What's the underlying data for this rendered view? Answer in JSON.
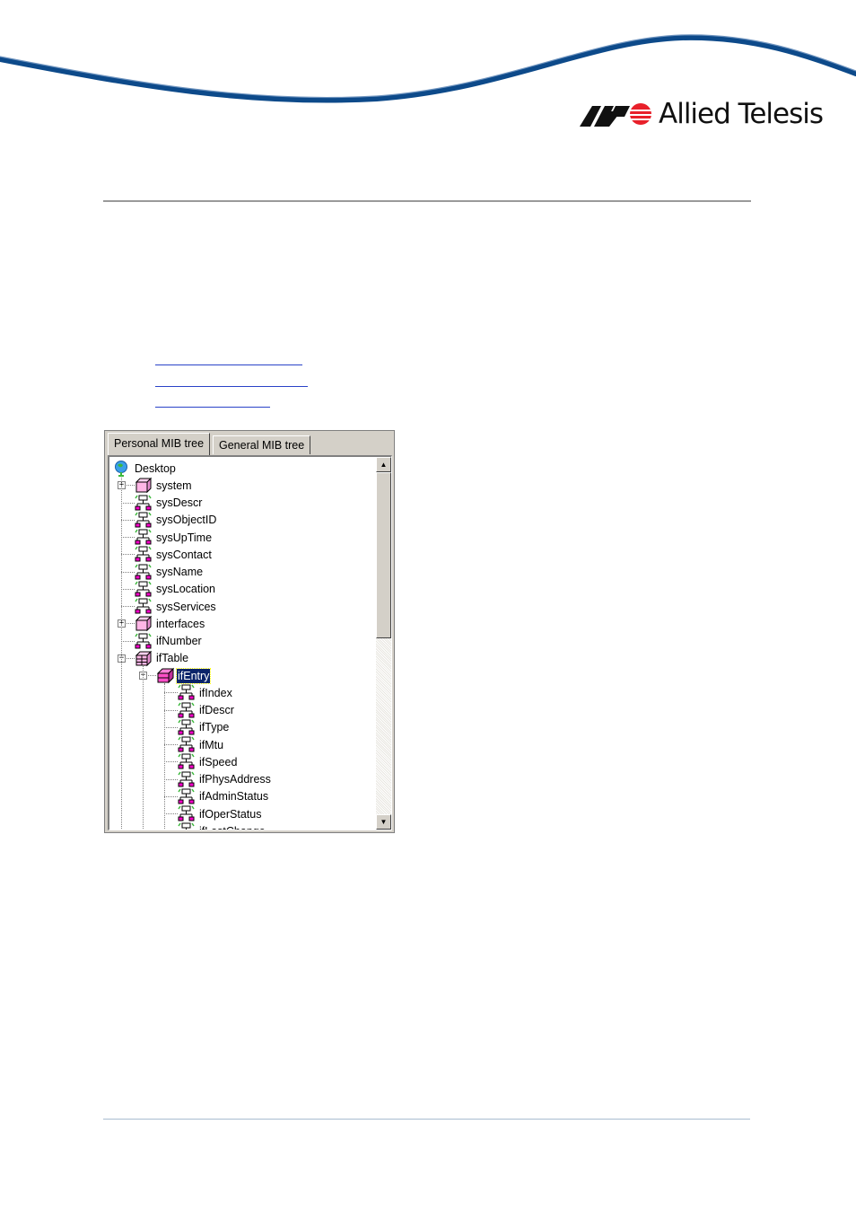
{
  "brand": {
    "name": "Allied Telesis",
    "swoosh_color": "#0d4a8a",
    "logo_accent": "#e8202a"
  },
  "mib_browser": {
    "tabs": [
      {
        "label": "Personal MIB tree",
        "active": true
      },
      {
        "label": "General MIB tree",
        "active": false
      }
    ],
    "tree": [
      {
        "label": "Desktop",
        "icon": "globe-icon",
        "level": 0
      },
      {
        "label": "system",
        "icon": "folder-cube-icon",
        "level": 1,
        "expander": "+"
      },
      {
        "label": "sysDescr",
        "icon": "mib-object-icon",
        "level": 1
      },
      {
        "label": "sysObjectID",
        "icon": "mib-object-icon",
        "level": 1
      },
      {
        "label": "sysUpTime",
        "icon": "mib-object-icon",
        "level": 1
      },
      {
        "label": "sysContact",
        "icon": "mib-object-icon",
        "level": 1
      },
      {
        "label": "sysName",
        "icon": "mib-object-icon",
        "level": 1
      },
      {
        "label": "sysLocation",
        "icon": "mib-object-icon",
        "level": 1
      },
      {
        "label": "sysServices",
        "icon": "mib-object-icon",
        "level": 1
      },
      {
        "label": "interfaces",
        "icon": "folder-cube-icon",
        "level": 1,
        "expander": "+"
      },
      {
        "label": "ifNumber",
        "icon": "mib-object-icon",
        "level": 1
      },
      {
        "label": "ifTable",
        "icon": "table-cube-icon",
        "level": 1,
        "expander": "-"
      },
      {
        "label": "ifEntry",
        "icon": "entry-cube-icon",
        "level": 2,
        "expander": "-",
        "selected": true
      },
      {
        "label": "ifIndex",
        "icon": "mib-object-icon",
        "level": 3
      },
      {
        "label": "ifDescr",
        "icon": "mib-object-icon",
        "level": 3
      },
      {
        "label": "ifType",
        "icon": "mib-object-icon",
        "level": 3
      },
      {
        "label": "ifMtu",
        "icon": "mib-object-icon",
        "level": 3
      },
      {
        "label": "ifSpeed",
        "icon": "mib-object-icon",
        "level": 3
      },
      {
        "label": "ifPhysAddress",
        "icon": "mib-object-icon",
        "level": 3
      },
      {
        "label": "ifAdminStatus",
        "icon": "mib-object-icon",
        "level": 3
      },
      {
        "label": "ifOperStatus",
        "icon": "mib-object-icon",
        "level": 3
      },
      {
        "label": "ifLastChange",
        "icon": "mib-object-icon",
        "level": 3
      }
    ]
  }
}
